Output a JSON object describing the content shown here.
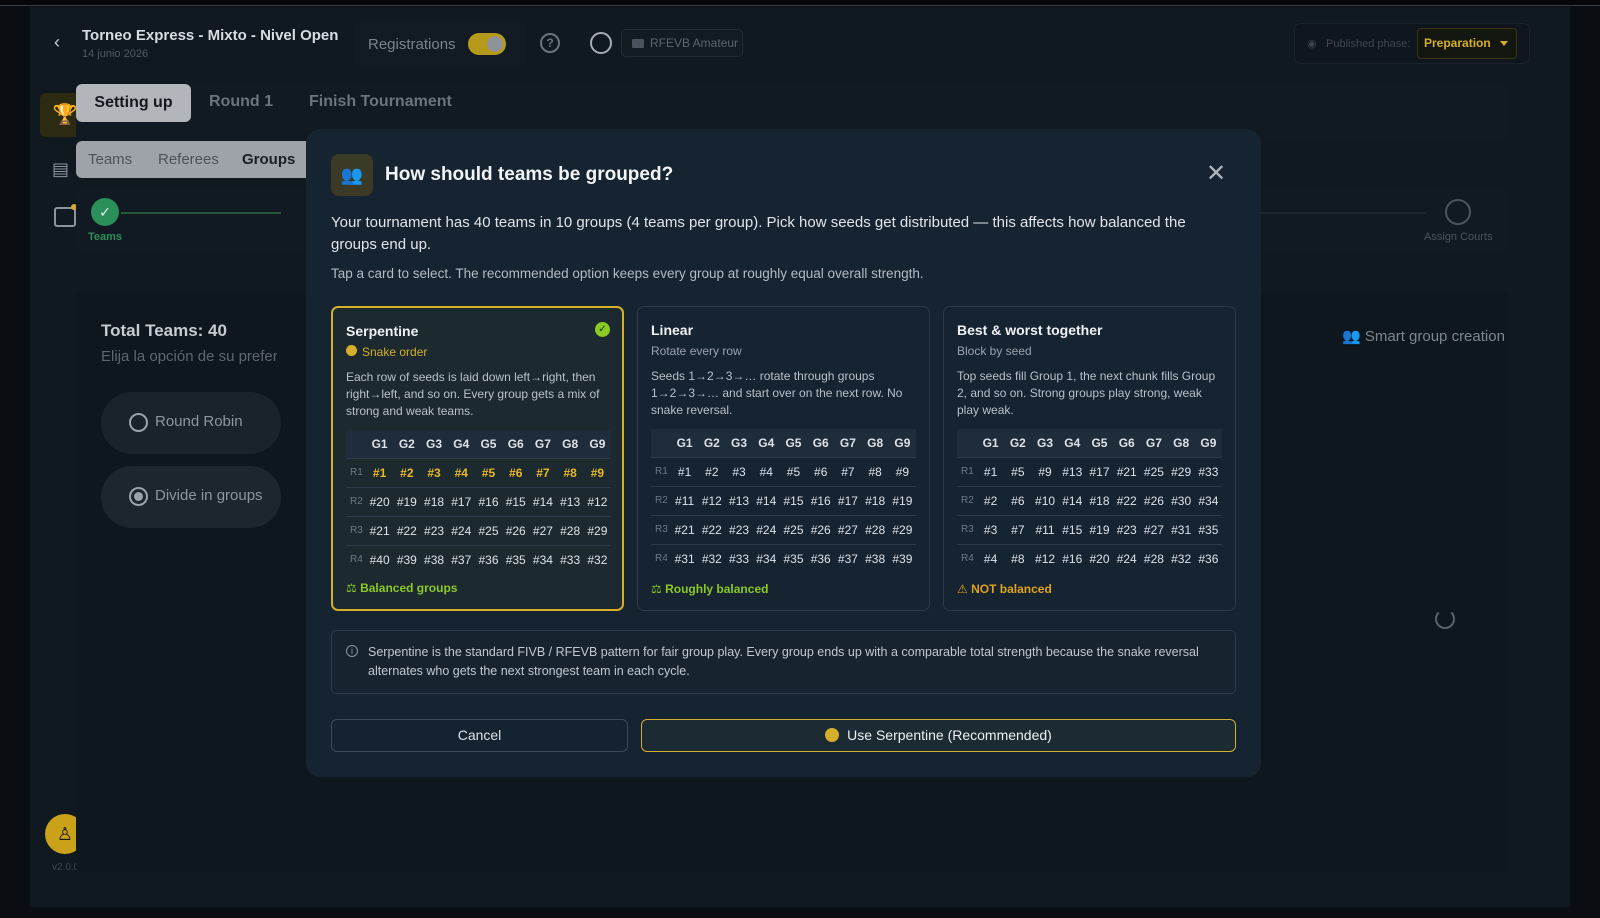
{
  "header": {
    "title": "Torneo Express - Mixto - Nivel Open",
    "date": "14 junio 2026",
    "registrations_label": "Registrations",
    "federation_badge": "RFEVB Amateur",
    "published_phase_label": "Published phase:",
    "published_phase_value": "Preparation"
  },
  "tabs": {
    "setup": "Setting up",
    "round1": "Round 1",
    "finish": "Finish Tournament"
  },
  "subtabs": {
    "teams": "Teams",
    "referees": "Referees",
    "groups": "Groups"
  },
  "stepper": {
    "first": "Teams",
    "last": "Assign Courts"
  },
  "main": {
    "total_teams": "Total Teams: 40",
    "hint": "Elija la opción de su preferencia",
    "option_round_robin": "Round Robin",
    "option_divide": "Divide in groups",
    "smart_group": "Smart group creation"
  },
  "sidebar": {
    "version": "v2.0.0"
  },
  "modal": {
    "title": "How should teams be grouped?",
    "description": "Your tournament has 40 teams in 10 groups (4 teams per group). Pick how seeds get distributed — this affects how balanced the groups end up.",
    "tap_hint": "Tap a card to select. The recommended option keeps every group at roughly equal overall strength.",
    "info": "Serpentine is the standard FIVB / RFEVB pattern for fair group play. Every group ends up with a comparable total strength because the snake reversal alternates who gets the next strongest team in each cycle.",
    "cancel": "Cancel",
    "confirm": "Use Serpentine (Recommended)"
  },
  "cards": [
    {
      "title": "Serpentine",
      "subtitle": "Snake order",
      "body": "Each row of seeds is laid down left→right, then right→left, and so on. Every group gets a mix of strong and weak teams.",
      "columns": [
        "G1",
        "G2",
        "G3",
        "G4",
        "G5",
        "G6",
        "G7",
        "G8",
        "G9"
      ],
      "rows": [
        {
          "label": "R1",
          "cells": [
            "#1",
            "#2",
            "#3",
            "#4",
            "#5",
            "#6",
            "#7",
            "#8",
            "#9"
          ]
        },
        {
          "label": "R2",
          "cells": [
            "#20",
            "#19",
            "#18",
            "#17",
            "#16",
            "#15",
            "#14",
            "#13",
            "#12"
          ]
        },
        {
          "label": "R3",
          "cells": [
            "#21",
            "#22",
            "#23",
            "#24",
            "#25",
            "#26",
            "#27",
            "#28",
            "#29"
          ]
        },
        {
          "label": "R4",
          "cells": [
            "#40",
            "#39",
            "#38",
            "#37",
            "#36",
            "#35",
            "#34",
            "#33",
            "#32"
          ]
        }
      ],
      "footer": "Balanced groups"
    },
    {
      "title": "Linear",
      "subtitle": "Rotate every row",
      "body": "Seeds 1→2→3→… rotate through groups 1→2→3→… and start over on the next row. No snake reversal.",
      "columns": [
        "G1",
        "G2",
        "G3",
        "G4",
        "G5",
        "G6",
        "G7",
        "G8",
        "G9"
      ],
      "rows": [
        {
          "label": "R1",
          "cells": [
            "#1",
            "#2",
            "#3",
            "#4",
            "#5",
            "#6",
            "#7",
            "#8",
            "#9"
          ]
        },
        {
          "label": "R2",
          "cells": [
            "#11",
            "#12",
            "#13",
            "#14",
            "#15",
            "#16",
            "#17",
            "#18",
            "#19"
          ]
        },
        {
          "label": "R3",
          "cells": [
            "#21",
            "#22",
            "#23",
            "#24",
            "#25",
            "#26",
            "#27",
            "#28",
            "#29"
          ]
        },
        {
          "label": "R4",
          "cells": [
            "#31",
            "#32",
            "#33",
            "#34",
            "#35",
            "#36",
            "#37",
            "#38",
            "#39"
          ]
        }
      ],
      "footer": "Roughly balanced"
    },
    {
      "title": "Best & worst together",
      "subtitle": "Block by seed",
      "body": "Top seeds fill Group 1, the next chunk fills Group 2, and so on. Strong groups play strong, weak play weak.",
      "columns": [
        "G1",
        "G2",
        "G3",
        "G4",
        "G5",
        "G6",
        "G7",
        "G8",
        "G9"
      ],
      "rows": [
        {
          "label": "R1",
          "cells": [
            "#1",
            "#5",
            "#9",
            "#13",
            "#17",
            "#21",
            "#25",
            "#29",
            "#33"
          ]
        },
        {
          "label": "R2",
          "cells": [
            "#2",
            "#6",
            "#10",
            "#14",
            "#18",
            "#22",
            "#26",
            "#30",
            "#34"
          ]
        },
        {
          "label": "R3",
          "cells": [
            "#3",
            "#7",
            "#11",
            "#15",
            "#19",
            "#23",
            "#27",
            "#31",
            "#35"
          ]
        },
        {
          "label": "R4",
          "cells": [
            "#4",
            "#8",
            "#12",
            "#16",
            "#20",
            "#24",
            "#28",
            "#32",
            "#36"
          ]
        }
      ],
      "footer": "NOT balanced"
    }
  ],
  "colors": {
    "accent": "#d5ae2a",
    "success": "#8ac926",
    "warning": "#e0a21e"
  }
}
